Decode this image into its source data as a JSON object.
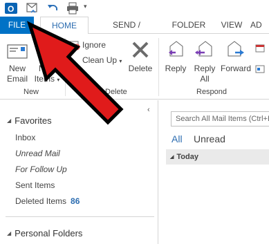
{
  "qat": {
    "icons": [
      "outlook-logo-icon",
      "send-receive-all-icon",
      "undo-icon",
      "print-icon"
    ]
  },
  "tabs": {
    "file": "FILE",
    "home": "HOME",
    "send_receive": "SEND / RECEIVE",
    "folder": "FOLDER",
    "view": "VIEW",
    "add": "AD"
  },
  "ribbon": {
    "new_email": [
      "New",
      "Email"
    ],
    "new_items": [
      "New",
      "Items"
    ],
    "new_group": "New",
    "ignore": "Ignore",
    "clean_up": "Clean Up",
    "delete": "Delete",
    "delete_group": "Delete",
    "reply": "Reply",
    "reply_all": [
      "Reply",
      "All"
    ],
    "forward": "Forward",
    "respond_group": "Respond"
  },
  "nav": {
    "favorites": "Favorites",
    "items": [
      {
        "label": "Inbox",
        "italic": false
      },
      {
        "label": "Unread Mail",
        "italic": true
      },
      {
        "label": "For Follow Up",
        "italic": true
      },
      {
        "label": "Sent Items",
        "italic": false
      },
      {
        "label": "Deleted Items",
        "italic": false,
        "count": "86"
      }
    ],
    "personal_folders": "Personal Folders"
  },
  "mail": {
    "search_placeholder": "Search All Mail Items (Ctrl+E)",
    "filter_all": "All",
    "filter_unread": "Unread",
    "group_today": "Today"
  },
  "colors": {
    "file_tab": "#0072c6",
    "accent_text": "#2b6cb0",
    "arrow_fill": "#e01b1b",
    "arrow_stroke": "#000000"
  }
}
